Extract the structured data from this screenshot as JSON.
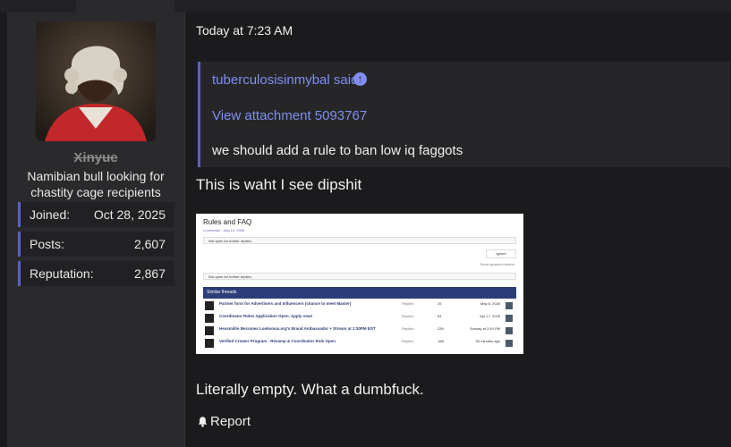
{
  "user": {
    "name": "Xinyue",
    "title": "Namibian bull looking for chastity cage recipients",
    "stats": [
      {
        "label": "Joined:",
        "value": "Oct 28, 2025"
      },
      {
        "label": "Posts:",
        "value": "2,607"
      },
      {
        "label": "Reputation:",
        "value": "2,867"
      }
    ]
  },
  "post": {
    "date": "Today at 7:23 AM",
    "quote": {
      "author": "tuberculosisinmybal said:",
      "attachment": "View attachment 5093767",
      "text": "we should add a rule to ban low iq faggots"
    },
    "message_1": "This is waht I see dipshit",
    "message_2": "Literally empty. What a dumbfuck.",
    "report_label": "Report",
    "embedded": {
      "title": "Rules and FAQ",
      "meta": "Lookismax · Aug 10, 2006",
      "not_open_1": "Not open for further replies.",
      "ignore_label": "Ignore",
      "show_ignored": "Show ignored content",
      "not_open_2": "Not open for further replies.",
      "similar_header": "Similar threads",
      "threads": [
        {
          "title": "Partner form for Advertisers and Influencers (chance to meet Master)",
          "replies": "25",
          "date": "May 8, 2026"
        },
        {
          "title": "Coordinator Roles Application Open. Apply now!",
          "replies": "54",
          "date": "Apr 17, 2026"
        },
        {
          "title": "Hexsmilite Becomes Looksmax.org's Brand Ambassador + Stream at 1:30PM EST",
          "replies": "239",
          "date": "Sunday at 2:54 PM"
        },
        {
          "title": "Verified Creator Program - Revamp & Coordinator Role Open",
          "replies": "188",
          "date": "53 minutes ago"
        }
      ],
      "replies_label": "Replies"
    }
  },
  "colors": {
    "accent": "#5962c9",
    "link": "#7f8ef0",
    "background": "#1b1b1d",
    "sidebar": "#2a2a2d"
  }
}
